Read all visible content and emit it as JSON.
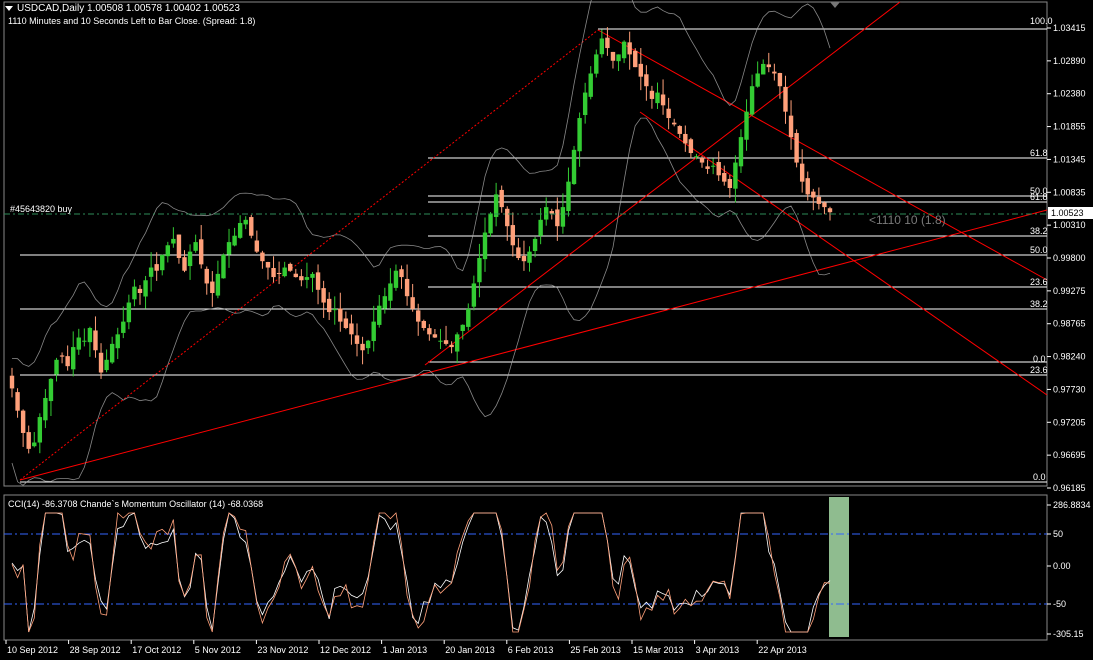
{
  "header": {
    "symbol_line": "USDCAD,Daily  1.00508 1.00578 1.00402 1.00523",
    "timer_line": "1110 Minutes and 10 Seconds Left to Bar Close. (Spread: 1.8)"
  },
  "order_label": "#45643820 buy",
  "countdown": "<1110 10 (1.8)",
  "current_price": "1.00523",
  "indicator_header": "CCI(14) -86.3708  Chande`s Momentum Oscillator (14) -68.0368",
  "price_axis": [
    "1.03415",
    "1.02890",
    "1.02380",
    "1.01855",
    "1.01345",
    "1.00835",
    "1.00310",
    "0.99800",
    "0.99275",
    "0.98765",
    "0.98240",
    "0.97730",
    "0.97205",
    "0.96695",
    "0.96185"
  ],
  "indicator_axis": [
    "286.8834",
    "50",
    "0.00",
    "-50",
    "-305.15"
  ],
  "date_axis": [
    "10 Sep 2012",
    "28 Sep 2012",
    "17 Oct 2012",
    "5 Nov 2012",
    "23 Nov 2012",
    "12 Dec 2012",
    "1 Jan 2013",
    "20 Jan 2013",
    "6 Feb 2013",
    "25 Feb 2013",
    "15 Mar 2013",
    "3 Apr 2013",
    "22 Apr 2013"
  ],
  "fib_labels": [
    {
      "text": "100.0"
    },
    {
      "text": "61.8"
    },
    {
      "text": "50.0"
    },
    {
      "text": "61.8"
    },
    {
      "text": "38.2"
    },
    {
      "text": "50.0"
    },
    {
      "text": "23.6"
    },
    {
      "text": "38.2"
    },
    {
      "text": "0.0"
    },
    {
      "text": "23.6"
    },
    {
      "text": "0.0"
    }
  ],
  "colors": {
    "background": "#000000",
    "bull_candle": "#33cc33",
    "bear_candle": "#ffa07a",
    "trendline": "#ff0000",
    "bands": "#aaaaaa",
    "indicator_levels": "#3366ff",
    "order_line": "#2e8b57",
    "highlight": "#8fbc8f"
  },
  "chart_data": {
    "type": "line",
    "instrument": "USDCAD",
    "timeframe": "Daily",
    "ohlc_last": {
      "open": 1.00508,
      "high": 1.00578,
      "low": 1.00402,
      "close": 1.00523
    },
    "ylim": [
      0.96185,
      1.03415
    ],
    "series": [
      {
        "values": [
          0.9775,
          0.974,
          0.9705,
          0.968,
          0.969,
          0.973,
          0.976,
          0.979,
          0.982,
          0.9825,
          0.981,
          0.984,
          0.9855,
          0.985,
          0.987,
          0.9835,
          0.98,
          0.982,
          0.9845,
          0.986,
          0.988,
          0.991,
          0.9935,
          0.9925,
          0.9945,
          0.9965,
          0.996,
          0.9985,
          1.0,
          1.001,
          0.998,
          0.996,
          0.999,
          1.0005,
          0.997,
          0.994,
          0.9925,
          0.9955,
          0.9985,
          1.0005,
          1.0015,
          1.0035,
          1.004,
          1.0015,
          0.999,
          0.9975,
          0.9965,
          0.995,
          0.9955,
          0.9965,
          0.996,
          0.995,
          0.9945,
          0.995,
          0.9955,
          0.993,
          0.991,
          0.9895,
          0.99,
          0.988,
          0.987,
          0.986,
          0.9845,
          0.9835,
          0.985,
          0.988,
          0.9905,
          0.992,
          0.994,
          0.996,
          0.995,
          0.992,
          0.99,
          0.988,
          0.987,
          0.986,
          0.9855,
          0.985,
          0.9845,
          0.984,
          0.986,
          0.9875,
          0.99,
          0.994,
          0.998,
          1.002,
          1.005,
          1.008,
          1.006,
          1.003,
          1.0,
          0.998,
          0.9975,
          0.999,
          1.001,
          1.004,
          1.006,
          1.005,
          1.003,
          1.006,
          1.01,
          1.015,
          1.02,
          1.024,
          1.027,
          1.03,
          1.0325,
          1.031,
          1.029,
          1.03,
          1.032,
          1.03,
          1.028,
          1.0265,
          1.025,
          1.023,
          1.024,
          1.022,
          1.02,
          1.019,
          1.0175,
          1.016,
          1.0145,
          1.014,
          1.013,
          1.012,
          1.0125,
          1.011,
          1.01,
          1.009,
          1.013,
          1.017,
          1.021,
          1.025,
          1.027,
          1.0285,
          1.028,
          1.027,
          1.025,
          1.021,
          1.017,
          1.013,
          1.01,
          1.008,
          1.0075,
          1.0065,
          1.006,
          1.0052
        ]
      }
    ]
  }
}
